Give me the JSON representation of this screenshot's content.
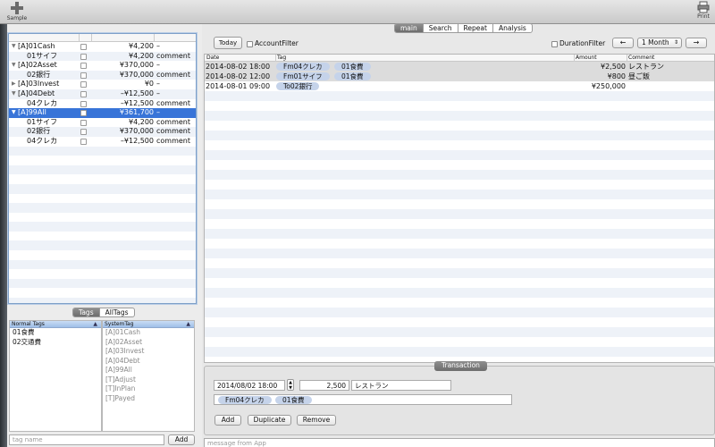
{
  "toolbar": {
    "left_button_label": "Sample",
    "right_button_label": "Print"
  },
  "accounts": {
    "rows": [
      {
        "name": "[A]01Cash",
        "amount": "¥4,200",
        "comment": "–",
        "expanded": true,
        "indent": 0
      },
      {
        "name": "01サイフ",
        "amount": "¥4,200",
        "comment": "comment",
        "indent": 1
      },
      {
        "name": "[A]02Asset",
        "amount": "¥370,000",
        "comment": "–",
        "expanded": true,
        "indent": 0
      },
      {
        "name": "02銀行",
        "amount": "¥370,000",
        "comment": "comment",
        "indent": 1
      },
      {
        "name": "[A]03Invest",
        "amount": "¥0",
        "comment": "–",
        "expanded": false,
        "indent": 0
      },
      {
        "name": "[A]04Debt",
        "amount": "–¥12,500",
        "comment": "–",
        "expanded": true,
        "indent": 0
      },
      {
        "name": "04クレカ",
        "amount": "–¥12,500",
        "comment": "comment",
        "indent": 1
      },
      {
        "name": "[A]99All",
        "amount": "¥361,700",
        "comment": "–",
        "expanded": true,
        "indent": 0,
        "selected": true
      },
      {
        "name": "01サイフ",
        "amount": "¥4,200",
        "comment": "comment",
        "indent": 1
      },
      {
        "name": "02銀行",
        "amount": "¥370,000",
        "comment": "comment",
        "indent": 1
      },
      {
        "name": "04クレカ",
        "amount": "–¥12,500",
        "comment": "comment",
        "indent": 1
      }
    ]
  },
  "tag_tabs": [
    "Tags",
    "AllTags"
  ],
  "tag_tabs_active": 0,
  "normal_tags": {
    "header": "Normal Tags",
    "items": [
      "01食費",
      "02交通費"
    ]
  },
  "system_tags": {
    "header": "SystemTag",
    "items": [
      "[A]01Cash",
      "[A]02Asset",
      "[A]03Invest",
      "[A]04Debt",
      "[A]99All",
      "[T]Adjust",
      "[T]InPlan",
      "[T]Payed"
    ]
  },
  "tag_input_placeholder": "tag name",
  "add_tag_label": "Add",
  "main_tabs": [
    "main",
    "Search",
    "Repeat",
    "Analysis"
  ],
  "main_tabs_active": 0,
  "filters": {
    "today_label": "Today",
    "account_filter_label": "AccountFilter",
    "duration_filter_label": "DurationFilter",
    "prev_label": "←",
    "next_label": "→",
    "period_value": "1 Month"
  },
  "transactions": {
    "columns": [
      "Date",
      "Tag",
      "Amount",
      "Comment"
    ],
    "rows": [
      {
        "date": "2014-08-02 18:00",
        "tags": [
          "Fm04クレカ",
          "01食費"
        ],
        "amount": "¥2,500",
        "comment": "レストラン",
        "highlighted": true
      },
      {
        "date": "2014-08-02 12:00",
        "tags": [
          "Fm01サイフ",
          "01食費"
        ],
        "amount": "¥800",
        "comment": "昼ご飯",
        "highlighted": true
      },
      {
        "date": "2014-08-01 09:00",
        "tags": [
          "To02銀行"
        ],
        "amount": "¥250,000",
        "comment": ""
      }
    ]
  },
  "transaction_editor": {
    "label": "Transaction",
    "datetime": "2014/08/02 18:00",
    "amount": "2,500",
    "comment": "レストラン",
    "tags": [
      "Fm04クレカ",
      "01食費"
    ],
    "add_label": "Add",
    "duplicate_label": "Duplicate",
    "remove_label": "Remove"
  },
  "message_placeholder": "message from App"
}
